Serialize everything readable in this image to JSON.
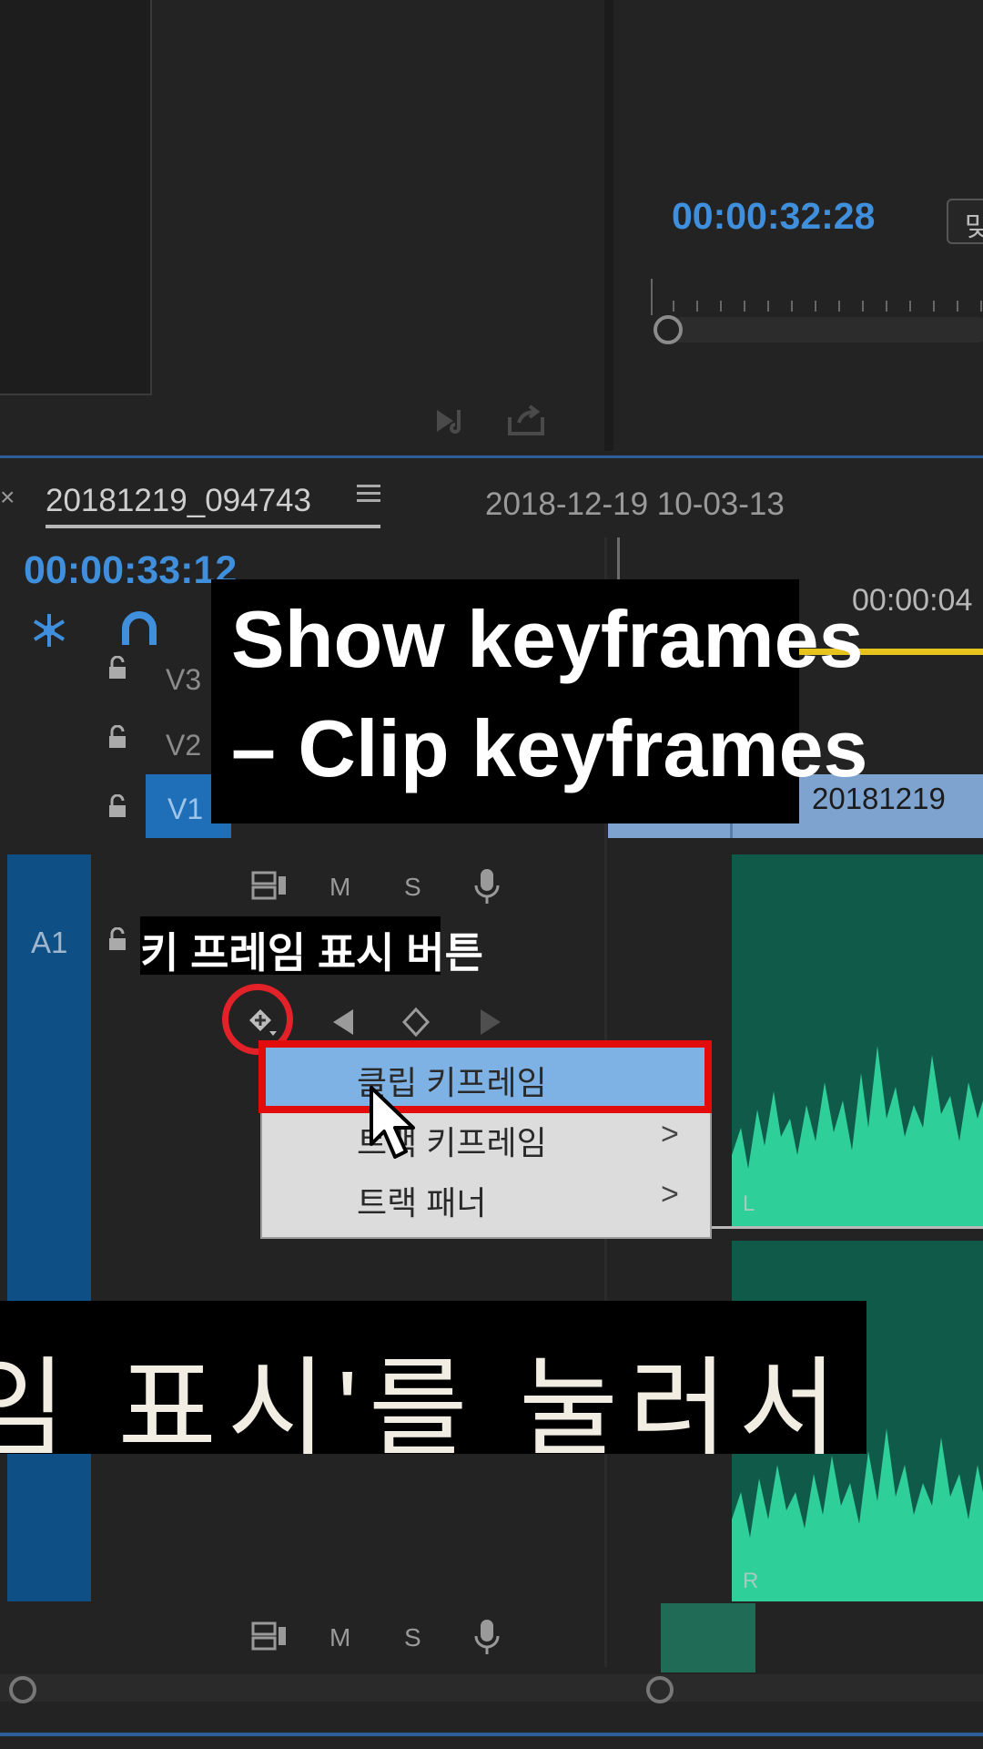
{
  "program_monitor": {
    "timecode": "00:00:32:28",
    "fit_label": "맞"
  },
  "timeline": {
    "sequence_tab": "20181219_094743",
    "sequence_date": "2018-12-19 10-03-13",
    "timecode": "00:00:33:12",
    "ruler_label": "00:00:04",
    "tracks": {
      "v3": "V3",
      "v2": "V2",
      "v1": "V1",
      "a1": "A1"
    },
    "v1_clip_name": "20181219",
    "audio_controls": {
      "mute": "M",
      "solo": "S"
    },
    "channel_left": "L",
    "channel_right": "R"
  },
  "context_menu": {
    "items": [
      {
        "label": "클립 키프레임",
        "has_submenu": false
      },
      {
        "label": "트랙 키프레임",
        "has_submenu": true
      },
      {
        "label": "트랙 패너",
        "has_submenu": true
      }
    ],
    "submenu_arrow": ">"
  },
  "captions": {
    "english_line1": "Show keyframes",
    "english_line2": "– Clip keyframes",
    "korean_small": "키 프레임 표시 버튼",
    "korean_big": "임 표시'를 눌러서"
  },
  "colors": {
    "timecode_blue": "#3f8fdc",
    "highlight_red": "#e32128",
    "menu_highlight": "#7fb2e4",
    "waveform": "#2fcf9a"
  },
  "icons": [
    "insert-icon",
    "export-icon",
    "nest-icon",
    "snap-magnet-icon",
    "lock-icon",
    "sync-lock-icon",
    "mic-icon",
    "keyframe-icon",
    "prev-keyframe-icon",
    "add-keyframe-icon",
    "next-keyframe-icon",
    "mouse-cursor-icon"
  ]
}
